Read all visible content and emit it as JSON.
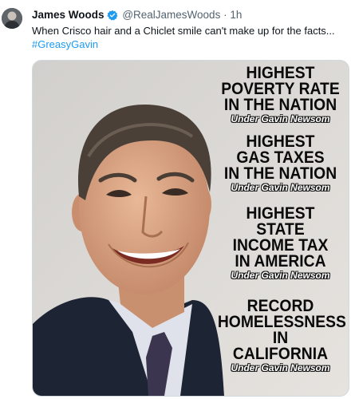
{
  "tweet": {
    "display_name": "James Woods",
    "handle": "@RealJamesWoods",
    "separator": "·",
    "time": "1h",
    "text": "When Crisco hair and a Chiclet smile can't make up for the facts...",
    "hashtag": "#GreasyGavin"
  },
  "image": {
    "blocks": [
      {
        "headline_lines": [
          "HIGHEST",
          "POVERTY RATE",
          "IN THE NATION"
        ],
        "sub": "Under Gavin Newsom"
      },
      {
        "headline_lines": [
          "HIGHEST",
          "GAS TAXES",
          "IN THE NATION"
        ],
        "sub": "Under Gavin Newsom"
      },
      {
        "headline_lines": [
          "HIGHEST",
          "STATE",
          "INCOME TAX",
          "IN AMERICA"
        ],
        "sub": "Under Gavin Newsom"
      },
      {
        "headline_lines": [
          "RECORD",
          "HOMELESSNESS",
          "IN",
          "CALIFORNIA"
        ],
        "sub": "Under Gavin Newsom"
      }
    ]
  },
  "colors": {
    "link": "#1d9bf0",
    "verified_badge": "#1d9bf0",
    "meta_text": "#536471"
  }
}
